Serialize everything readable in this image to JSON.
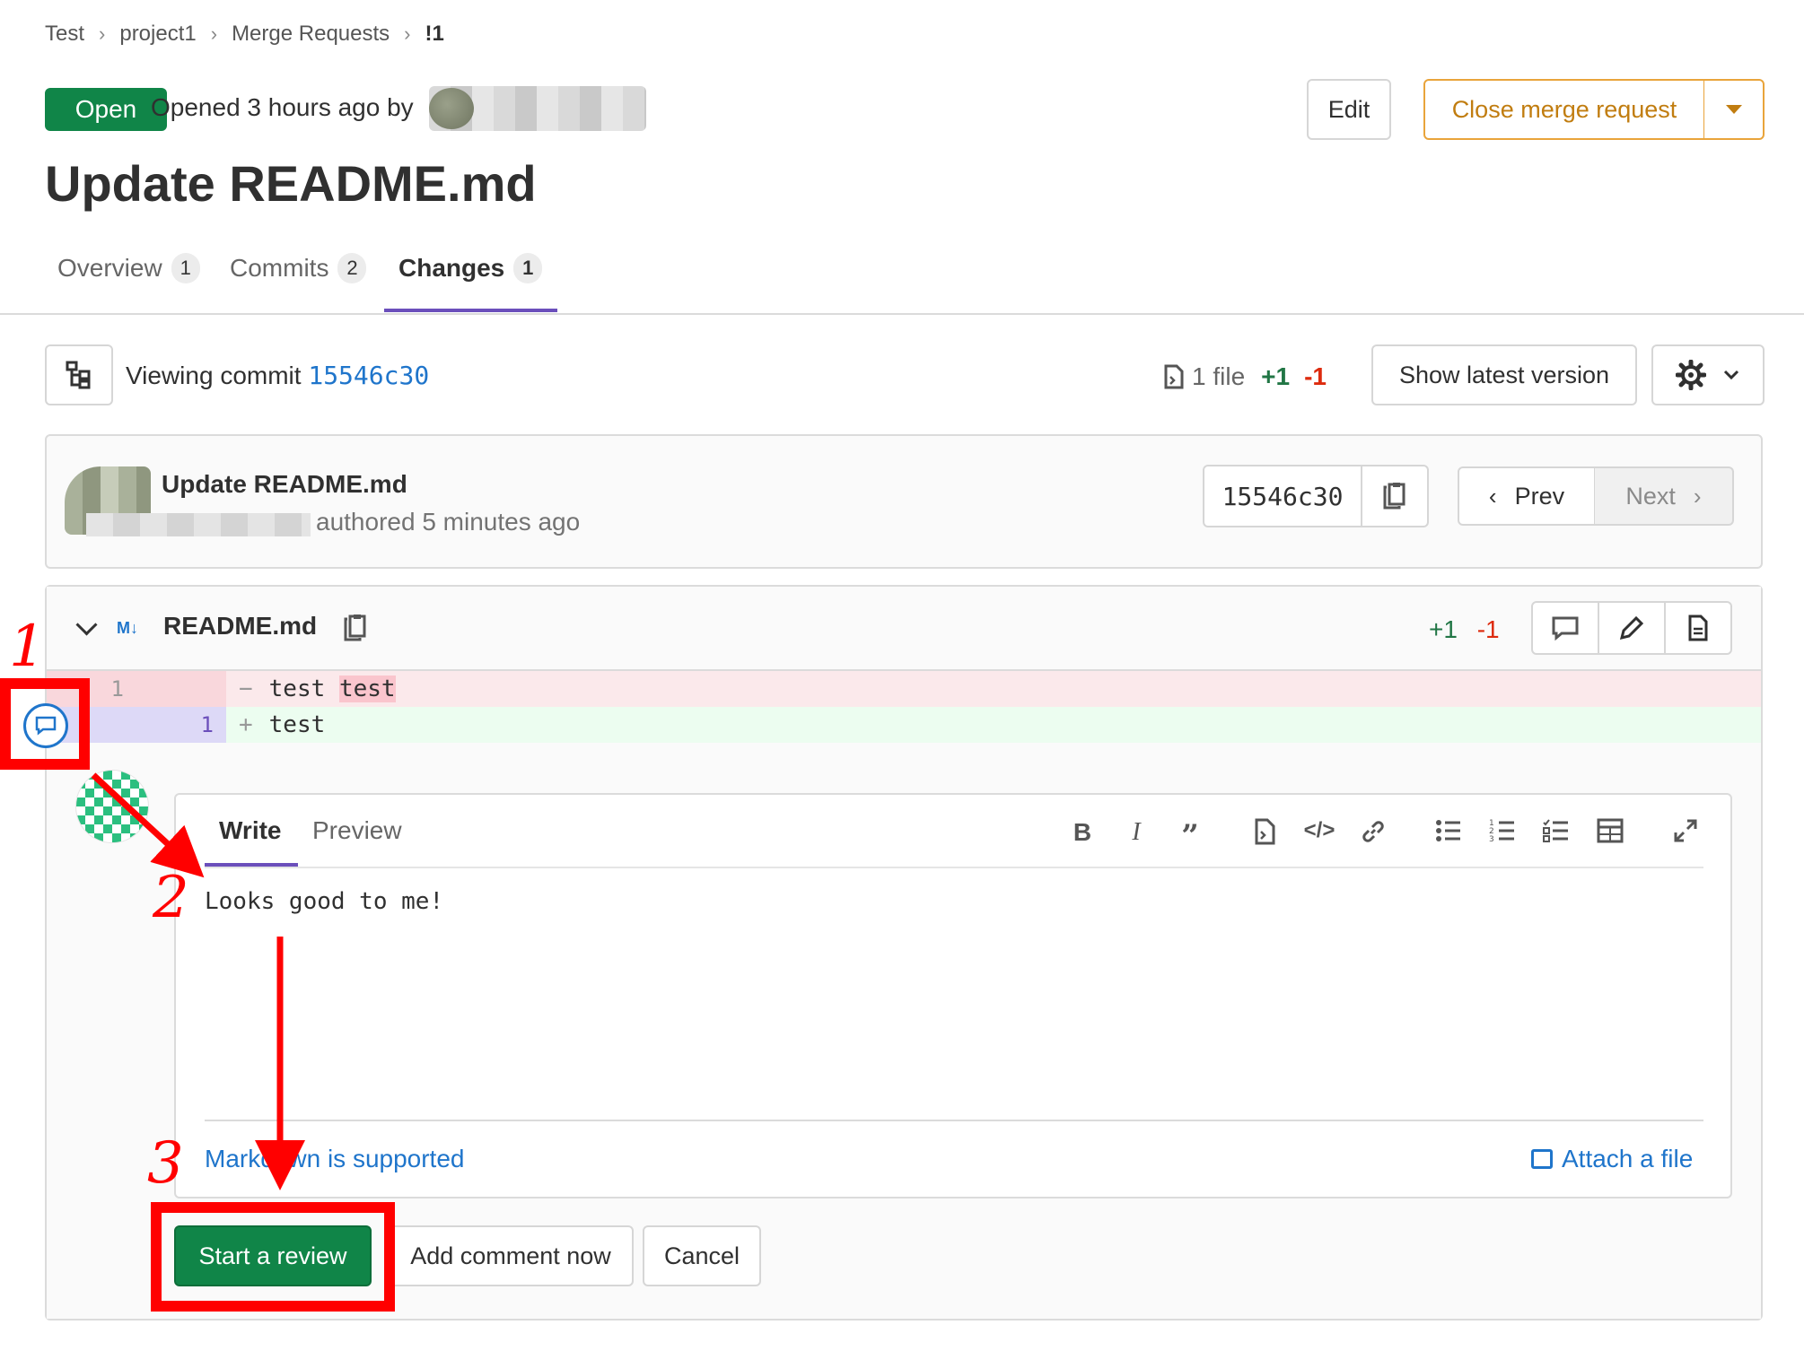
{
  "breadcrumb": [
    "Test",
    "project1",
    "Merge Requests",
    "!1"
  ],
  "header": {
    "status_badge": "Open",
    "opened_text": "Opened 3 hours ago by",
    "edit_label": "Edit",
    "close_label": "Close merge request",
    "title": "Update README.md"
  },
  "tabs": [
    {
      "label": "Overview",
      "count": "1"
    },
    {
      "label": "Commits",
      "count": "2"
    },
    {
      "label": "Changes",
      "count": "1"
    }
  ],
  "viewing": {
    "prefix": "Viewing commit",
    "sha": "15546c30",
    "files": "1 file",
    "additions": "+1",
    "deletions": "-1",
    "show_latest": "Show latest version"
  },
  "commit": {
    "title": "Update README.md",
    "authored": "authored 5 minutes ago",
    "sha": "15546c30",
    "prev": "Prev",
    "next": "Next"
  },
  "file": {
    "name": "README.md",
    "type_icon": "M↓",
    "additions": "+1",
    "deletions": "-1",
    "lines": [
      {
        "old": "1",
        "new": "",
        "sign": "−",
        "text": "test",
        "highlight": "test"
      },
      {
        "old": "",
        "new": "1",
        "sign": "+",
        "text": "test"
      }
    ]
  },
  "editor": {
    "tabs": [
      "Write",
      "Preview"
    ],
    "content": "Looks good to me!",
    "markdown_hint": "Markdown is supported",
    "attach_label": "Attach a file",
    "toolbar_icons": [
      "bold-icon",
      "italic-icon",
      "quote-icon",
      "insert-suggestion-icon",
      "code-icon",
      "link-icon",
      "bullet-list-icon",
      "numbered-list-icon",
      "task-list-icon",
      "table-icon",
      "fullscreen-icon"
    ]
  },
  "actions": {
    "start_review": "Start a review",
    "add_comment_now": "Add comment now",
    "cancel": "Cancel"
  },
  "annotations": [
    "1",
    "2",
    "3"
  ],
  "colors": {
    "accent_purple": "#6b4fbb",
    "open_green": "#108548",
    "close_orange": "#c17d10",
    "link_blue": "#1f75cb",
    "annotation_red": "#ff0000"
  }
}
